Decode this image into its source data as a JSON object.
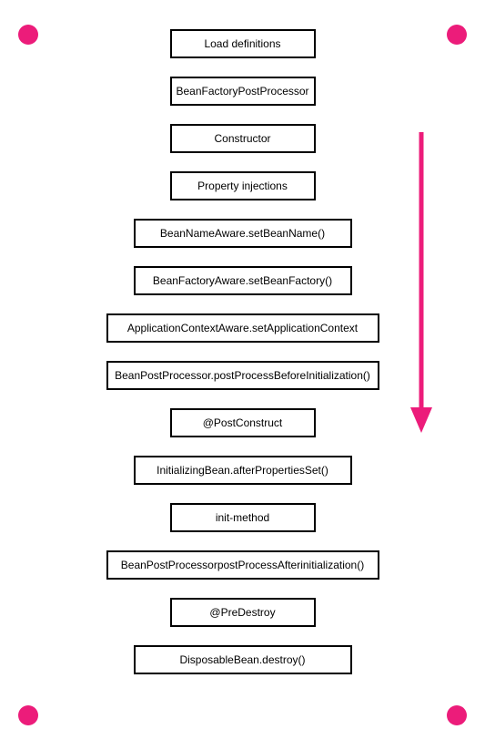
{
  "dot_color": "#ec1c7a",
  "arrow_color": "#ec1c7a",
  "steps": [
    {
      "label": "Load definitions",
      "size": "small"
    },
    {
      "label": "BeanFactoryPostProcessor",
      "size": "small"
    },
    {
      "label": "Constructor",
      "size": "small"
    },
    {
      "label": "Property injections",
      "size": "small"
    },
    {
      "label": "BeanNameAware.setBeanName()",
      "size": "medium"
    },
    {
      "label": "BeanFactoryAware.setBeanFactory()",
      "size": "medium"
    },
    {
      "label": "ApplicationContextAware.setApplicationContext",
      "size": "large"
    },
    {
      "label": "BeanPostProcessor.postProcessBeforeInitialization()",
      "size": "large"
    },
    {
      "label": "@PostConstruct",
      "size": "small"
    },
    {
      "label": "InitializingBean.afterPropertiesSet()",
      "size": "medium"
    },
    {
      "label": "init-method",
      "size": "small"
    },
    {
      "label": "BeanPostProcessorpostProcessAfterinitialization()",
      "size": "large"
    },
    {
      "label": "@PreDestroy",
      "size": "small"
    },
    {
      "label": "DisposableBean.destroy()",
      "size": "medium"
    }
  ]
}
